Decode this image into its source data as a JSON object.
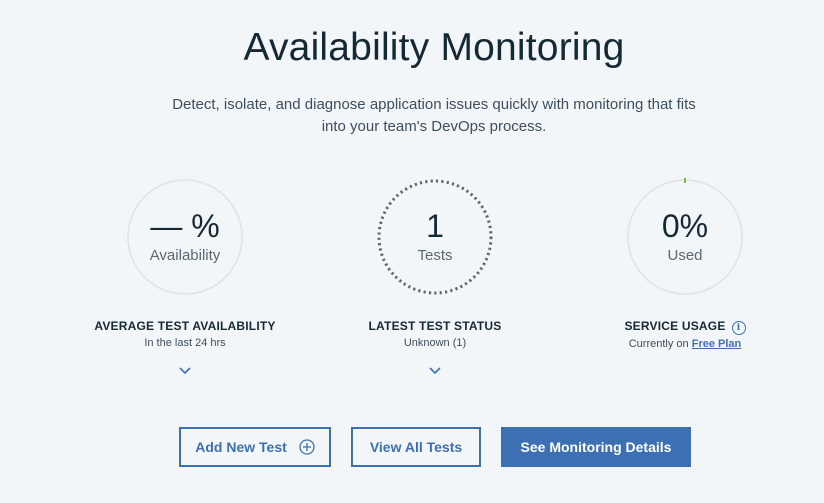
{
  "header": {
    "title": "Availability Monitoring",
    "subtitle": "Detect, isolate, and diagnose application issues quickly with monitoring that fits into your team's DevOps process."
  },
  "metrics": [
    {
      "value": "— %",
      "label": "Availability",
      "heading": "AVERAGE TEST AVAILABILITY",
      "detail": "In the last 24 hrs"
    },
    {
      "value": "1",
      "label": "Tests",
      "heading": "LATEST TEST STATUS",
      "detail": "Unknown (1)"
    },
    {
      "value": "0%",
      "label": "Used",
      "heading": "SERVICE USAGE",
      "detail_prefix": "Currently on",
      "detail_link": "Free Plan",
      "usage_fraction": 0
    }
  ],
  "buttons": {
    "add_test": "Add New Test",
    "view_all": "View All Tests",
    "details": "See Monitoring Details"
  },
  "icons": {
    "info": "info-icon",
    "plus": "plus-circle-icon",
    "chevron": "chevron-down-icon"
  },
  "colors": {
    "accent": "#3d70b2",
    "gauge_track": "#dfe3e6",
    "usage_tick": "#5aa700",
    "dashed_ring": "#5a6872"
  }
}
